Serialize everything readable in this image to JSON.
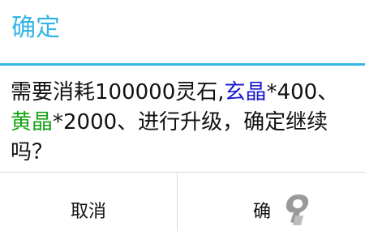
{
  "dialog": {
    "title": "确定",
    "message": {
      "part1": "需要消耗100000灵石,",
      "item1": "玄晶",
      "part2": "*400、",
      "item2": "黄晶",
      "part3": "*2000、进行升级，确定继续吗？"
    },
    "buttons": {
      "cancel": "取消",
      "confirm": "确"
    }
  },
  "watermark": {
    "text": "九游"
  },
  "colors": {
    "accent": "#33b5e5",
    "item1": "#1a1acc",
    "item2": "#17a317",
    "text": "#111111",
    "divider": "#d9d9d9"
  }
}
